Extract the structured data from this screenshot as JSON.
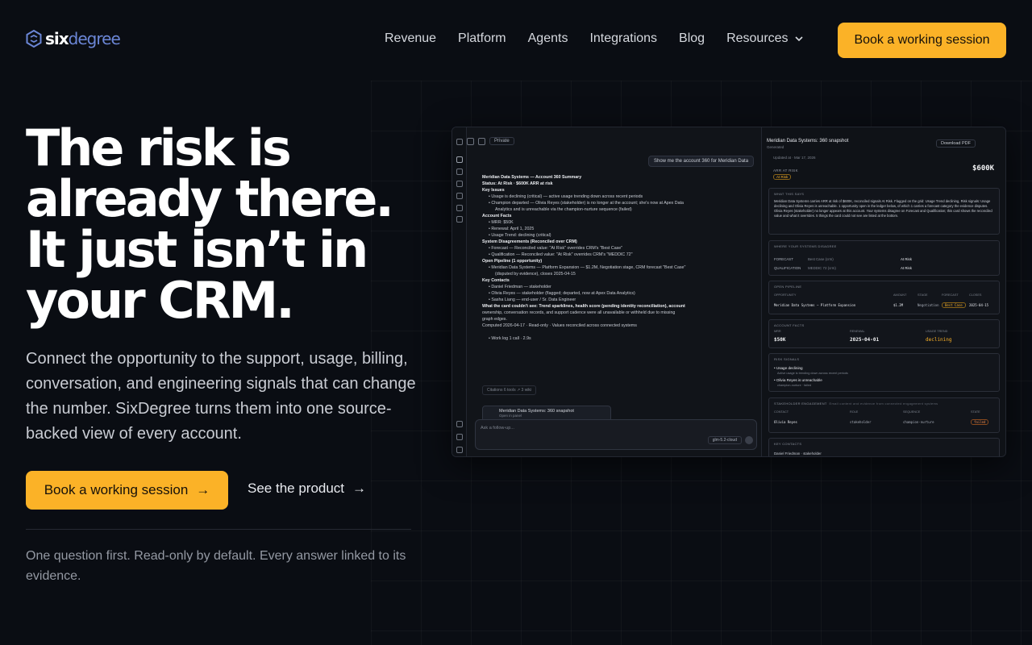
{
  "brand": {
    "six": "six",
    "degree": "degree"
  },
  "nav": {
    "links": [
      "Revenue",
      "Platform",
      "Agents",
      "Integrations",
      "Blog"
    ],
    "resources": "Resources",
    "cta": "Book a working session"
  },
  "hero": {
    "title_lines": [
      "The risk is",
      "already there.",
      "It just isn’t in",
      "your CRM."
    ],
    "subtitle": "Connect the opportunity to the support, usage, billing, conversation, and engineering signals that can change the number. SixDegree turns them into one source-backed view of every account.",
    "cta": "Book a working session",
    "cta_arrow": "→",
    "secondary": "See the product",
    "secondary_arrow": "→",
    "note": "One question first. Read-only by default. Every answer linked to its evidence."
  },
  "shot": {
    "visibility": "Private",
    "question": "Show me the account 360 for Meridian Data",
    "chat": [
      {
        "t": "Meridian Data Systems — Account 360 Summary",
        "c": "b"
      },
      {
        "t": "Status: At Risk · $600K ARR at risk",
        "c": "b"
      },
      {
        "t": "Key Issues",
        "c": "b"
      },
      {
        "t": "• Usage is declining (critical) — active usage trending down across recent periods",
        "c": "li"
      },
      {
        "t": "• Champion departed — Olivia Reyes (stakeholder) is no longer at the account; she's now at Apex Data",
        "c": "li"
      },
      {
        "t": "Analytics and is unreachable via the champion-nurture sequence (failed)",
        "c": "li2"
      },
      {
        "t": "Account Facts",
        "c": "b"
      },
      {
        "t": "• MRR: $50K",
        "c": "li"
      },
      {
        "t": "• Renewal: April 1, 2025",
        "c": "li"
      },
      {
        "t": "• Usage Trend: declining (critical)",
        "c": "li"
      },
      {
        "t": "System Disagreements (Reconciled over CRM)",
        "c": "b"
      },
      {
        "t": "• Forecast — Reconciled value: \"At Risk\" overrides CRM's \"Best Case\"",
        "c": "li"
      },
      {
        "t": "• Qualification — Reconciled value: \"At Risk\" overrides CRM's \"MEDDIC 72\"",
        "c": "li"
      },
      {
        "t": "Open Pipeline (1 opportunity)",
        "c": "b"
      },
      {
        "t": "• Meridian Data Systems — Platform Expansion — $1.2M, Negotiation stage, CRM forecast \"Best Case\"",
        "c": "li"
      },
      {
        "t": "(disputed by evidence), closes 2025-04-15",
        "c": "li2"
      },
      {
        "t": "Key Contacts",
        "c": "b"
      },
      {
        "t": "• Daniel Friedman — stakeholder",
        "c": "li"
      },
      {
        "t": "• Olivia Reyes — stakeholder (flagged; departed, now at Apex Data Analytics)",
        "c": "li"
      },
      {
        "t": "• Sasha Liang — end-user / Sr. Data Engineer",
        "c": "li"
      },
      {
        "t": "What the card couldn't see: Trend sparklines, health score (pending identity reconciliation), account",
        "c": "b"
      },
      {
        "t": "ownership, conversation records, and support cadence were all unavailable or withheld due to missing",
        "c": ""
      },
      {
        "t": "graph edges.",
        "c": ""
      },
      {
        "t": "Computed 2026-04-17 · Read-only · Values reconciled across connected systems",
        "c": ""
      },
      {
        "t": "",
        "c": ""
      },
      {
        "t": "• Work log  1 call · 2.9s",
        "c": "li"
      }
    ],
    "tools": "Citations   6 tools   ↗ 3 wiki",
    "card": "Meridian Data Systems: 360 snapshot",
    "card_sub": "Open in panel",
    "input_placeholder": "Ask a follow-up...",
    "model": "glm-5.2-cloud",
    "panel": {
      "title": "Meridian Data Systems: 360 snapshot",
      "subtitle": "Generated",
      "download": "Download PDF",
      "meta": "Updated at · Mar 17, 2026",
      "arr_label": "ARR AT RISK",
      "arr": "$600K",
      "status": "At Risk",
      "why_h": "WHAT THIS SAYS",
      "why_t": "Meridian Data Systems carries ARR at risk of $600K, reconciled signals At Risk. Flagged on the grid: Usage Trend declining, Risk signals: Usage declining and Olivia Reyes is unreachable. 1 opportunity open in the ledger below, of which 1 carries a forecast category the evidence disputes. Olivia Reyes (stakeholder) no longer appears at this account. Your systems disagree on Forecast and Qualification; this card shows the reconciled value and what it overrides. 5 things the card could not see are listed at the bottom.",
      "disagree_h": "WHERE YOUR SYSTEMS DISAGREE",
      "disagree_rows": [
        [
          "FORECAST",
          "Best Case (crm)",
          "At Risk"
        ],
        [
          "QUALIFICATION",
          "MEDDIC 72 (crm)",
          "At Risk"
        ]
      ],
      "pipe_h": "OPEN PIPELINE",
      "pipe_cols": [
        "OPPORTUNITY",
        "AMOUNT",
        "STAGE",
        "FORECAST",
        "CLOSES"
      ],
      "pipe_row": [
        "Meridian Data Systems — Platform Expansion",
        "$1.2M",
        "Negotiation",
        "Best Case",
        "2025-04-15"
      ],
      "facts_h": "ACCOUNT FACTS",
      "facts_cols": [
        "MRR",
        "RENEWAL",
        "USAGE TREND"
      ],
      "facts_vals": [
        "$50K",
        "2025-04-01",
        "declining"
      ],
      "risk_h": "RISK SIGNALS",
      "risks": [
        [
          "• Usage declining",
          "Active usage is trending down across recent periods"
        ],
        [
          "• Olivia Reyes is unreachable",
          "champion-nurture · failed"
        ]
      ],
      "stake_h": "STAKEHOLDER ENGAGEMENT",
      "stake_note": "Email content and evidence from connected engagement systems",
      "stake_cols": [
        "CONTACT",
        "ROLE",
        "SEQUENCE",
        "STATE"
      ],
      "stake_row": [
        "Olivia Reyes",
        "stakeholder",
        "champion-nurture",
        "failed"
      ],
      "contacts_h": "KEY CONTACTS",
      "contact_1": "Daniel Friedman · stakeholder"
    }
  }
}
